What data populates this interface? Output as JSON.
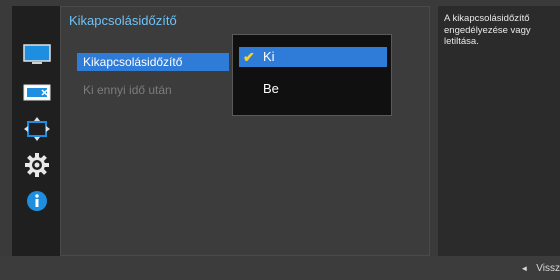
{
  "main": {
    "title": "Kikapcsolásidőzítő",
    "items": [
      {
        "label": "Kikapcsolásidőzítő"
      },
      {
        "label": "Ki ennyi idő után"
      }
    ]
  },
  "dropdown": {
    "options": [
      {
        "label": "Ki",
        "selected": true
      },
      {
        "label": "Be",
        "selected": false
      }
    ]
  },
  "help": {
    "text": "A kikapcsolásidőzítő engedélyezése vagy letiltása."
  },
  "footer": {
    "back_label": "Vissz"
  },
  "sidebar": {
    "icons": [
      "picture-icon",
      "screen-icon",
      "position-icon",
      "settings-gear-icon",
      "info-icon"
    ]
  },
  "colors": {
    "accent": "#2e7bd8",
    "title": "#6fc3f7",
    "check": "#f2d22b"
  }
}
